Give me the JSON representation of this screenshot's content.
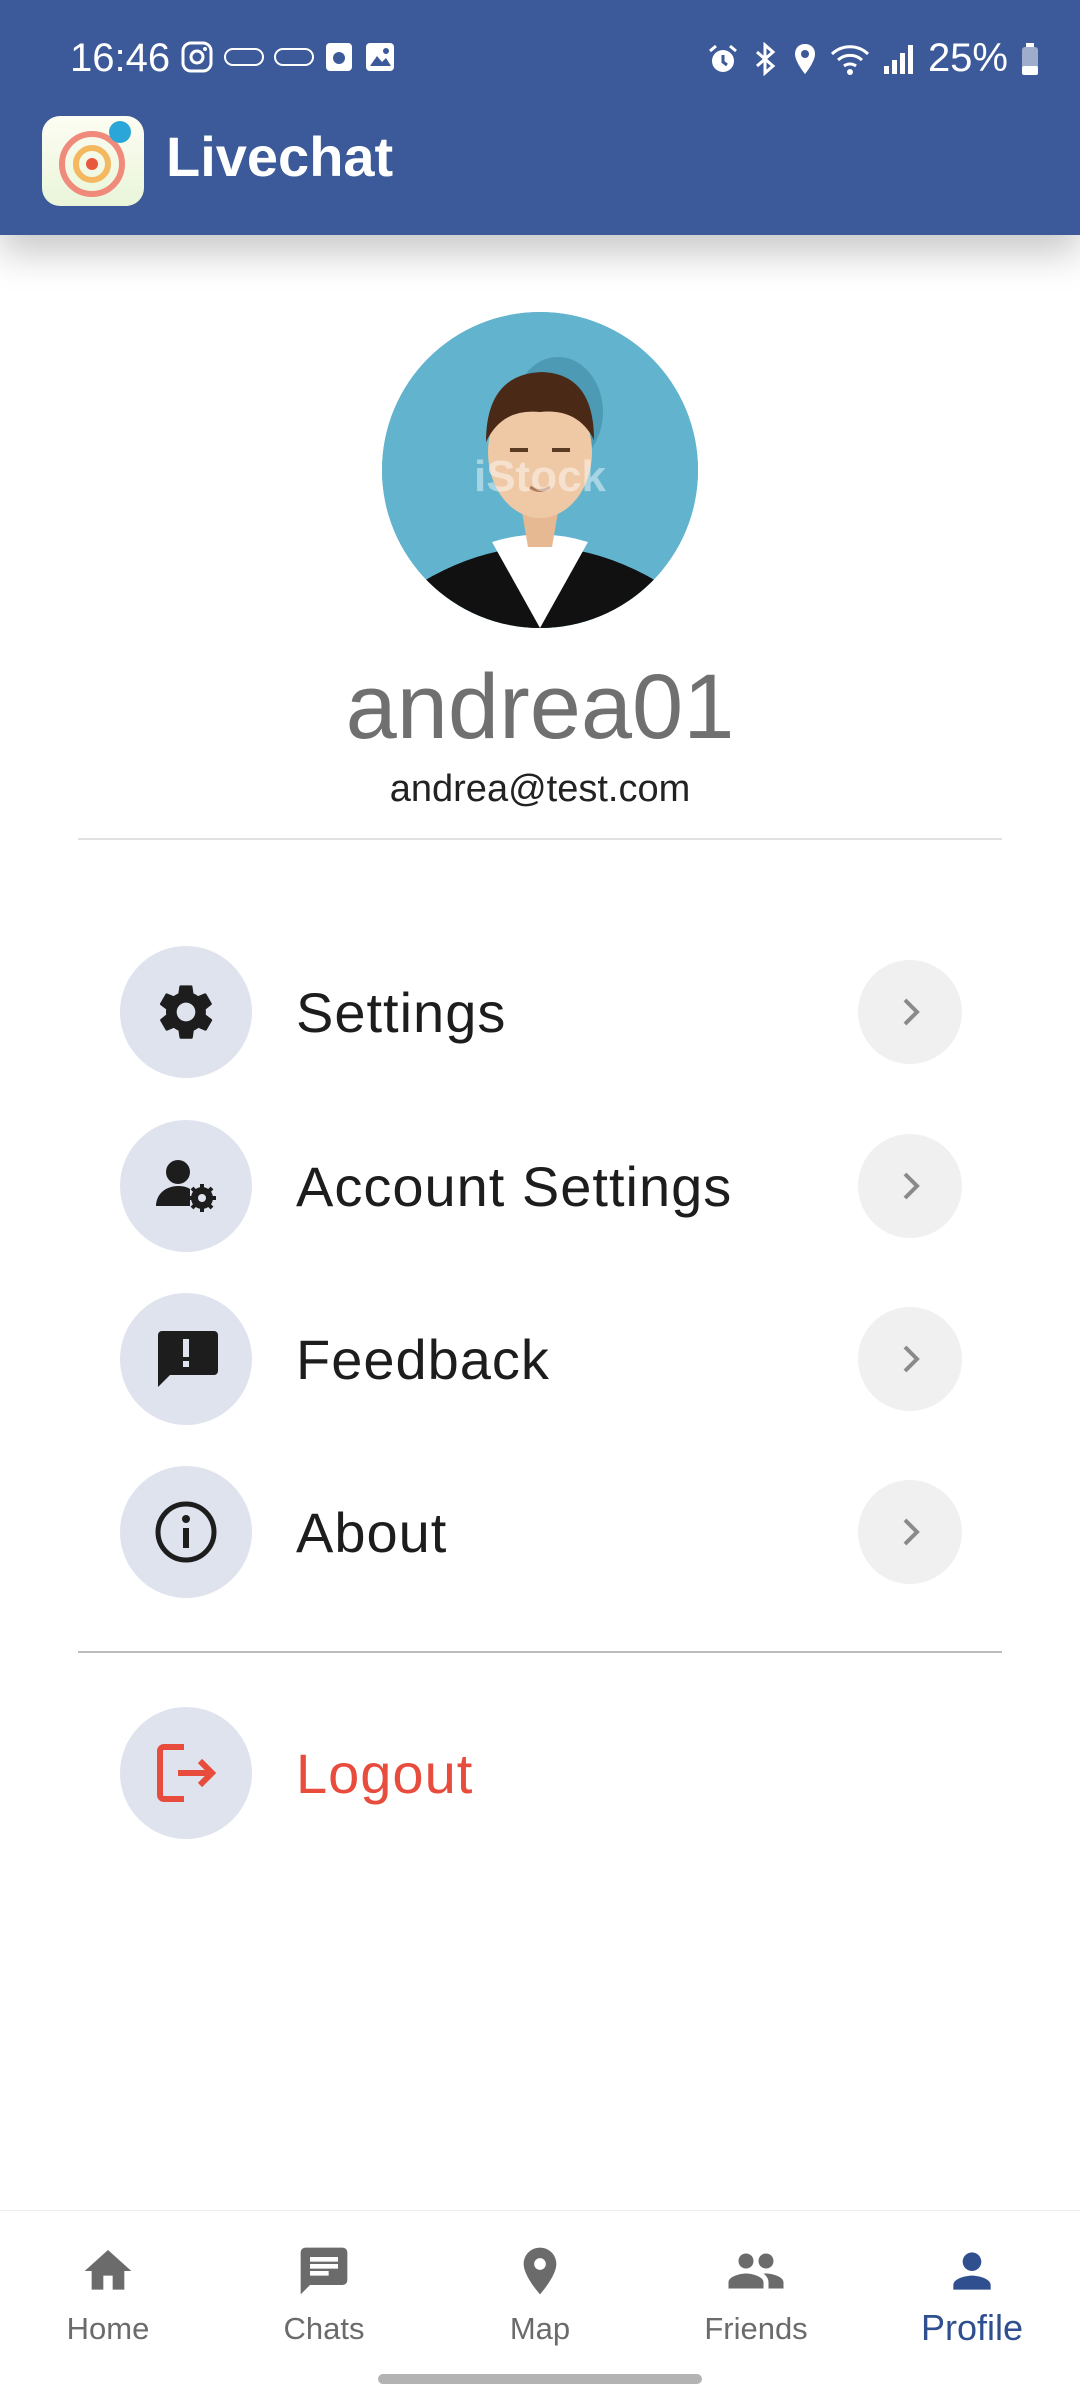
{
  "status_bar": {
    "time": "16:46",
    "battery": "25%"
  },
  "app": {
    "title": "Livechat"
  },
  "profile": {
    "username": "andrea01",
    "email": "andrea@test.com",
    "avatar_watermark": "iStock"
  },
  "menu": {
    "items": [
      {
        "label": "Settings",
        "icon": "gear-icon"
      },
      {
        "label": "Account Settings",
        "icon": "user-cog-icon"
      },
      {
        "label": "Feedback",
        "icon": "feedback-icon"
      },
      {
        "label": "About",
        "icon": "info-icon"
      }
    ],
    "logout": {
      "label": "Logout",
      "icon": "logout-icon",
      "color": "#e74c3c"
    }
  },
  "bottom_nav": {
    "items": [
      {
        "label": "Home",
        "icon": "home-icon"
      },
      {
        "label": "Chats",
        "icon": "chat-icon"
      },
      {
        "label": "Map",
        "icon": "map-pin-icon"
      },
      {
        "label": "Friends",
        "icon": "friends-icon"
      },
      {
        "label": "Profile",
        "icon": "profile-icon",
        "active": true
      }
    ],
    "active_color": "#2f4f8f"
  },
  "colors": {
    "appbar": "#3c5a99",
    "icon_circle": "#dfe3ee",
    "logout": "#e74c3c"
  }
}
